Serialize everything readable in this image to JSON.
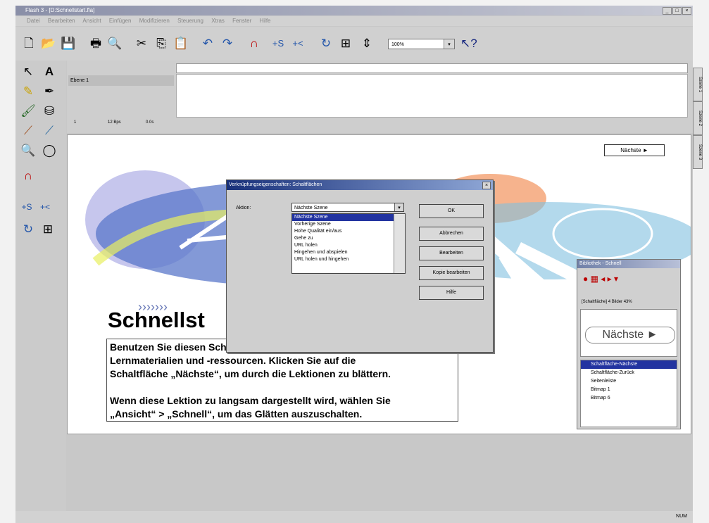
{
  "window": {
    "title": "Flash 3 - [D:Schnellstart.fla]"
  },
  "menu": [
    "Datei",
    "Bearbeiten",
    "Ansicht",
    "Einfügen",
    "Modifizieren",
    "Steuerung",
    "Xtras",
    "Fenster",
    "Hilfe"
  ],
  "toolbar": {
    "zoom": "100%"
  },
  "timeline": {
    "layer": "Ebene 1",
    "frame": "1",
    "fps": "12 Bps",
    "time": "0.0s"
  },
  "stage": {
    "title": "Schnellst",
    "next_button": "Nächste ►",
    "text": "Benutzen Sie diesen Schnellstart als Leitfaden für die Flash-\nLernmaterialien und -ressourcen. Klicken Sie auf die\nSchaltfläche „Nächste“, um durch die Lektionen zu blättern.\n\nWenn diese Lektion zu langsam dargestellt wird, wählen Sie\n„Ansicht“ > „Schnell“, um das Glätten auszuschalten."
  },
  "dialog": {
    "title": "Verknüpfungseigenschaften: Schaltflächen",
    "label": "Aktion:",
    "selected": "Nächste Szene",
    "options": [
      "Nächste Szene",
      "Vorherige Szene",
      "Hohe Qualität ein/aus",
      "Gehe zu",
      "URL holen",
      "Hingehen und abspielen",
      "URL holen und hingehen"
    ],
    "buttons": [
      "OK",
      "Abbrechen",
      "Bearbeiten",
      "Kopie bearbeiten",
      "Hilfe"
    ]
  },
  "library": {
    "title": "Bibliothek - Schnell",
    "info": "[Schaltfläche] 4 Bilder 43%",
    "preview": "Nächste ►",
    "items": [
      "Schaltfläche-Nächste",
      "Schaltfläche-Zurück",
      "Seitenleiste",
      "Bitmap 1",
      "Bitmap 6"
    ]
  },
  "tabs": [
    "Szene 1",
    "Szene 2",
    "Szene 3"
  ],
  "status": "NUM"
}
